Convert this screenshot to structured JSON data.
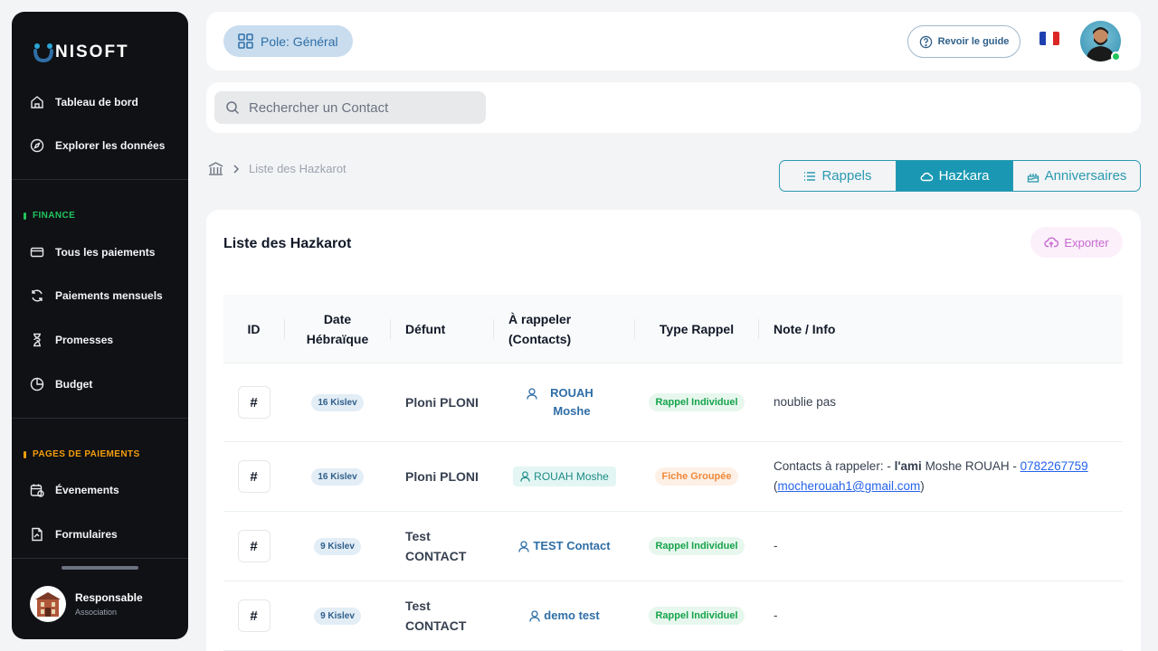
{
  "brand": {
    "logo_text": "NISOFT"
  },
  "sidebar": {
    "items": [
      {
        "label": "Tableau de bord",
        "icon": "home-icon"
      },
      {
        "label": "Explorer les données",
        "icon": "compass-icon"
      }
    ],
    "sections": [
      {
        "label": "FINANCE",
        "color": "#22c55e",
        "items": [
          {
            "label": "Tous les paiements",
            "icon": "credit-card-icon"
          },
          {
            "label": "Paiements mensuels",
            "icon": "refresh-icon"
          },
          {
            "label": "Promesses",
            "icon": "hourglass-icon"
          },
          {
            "label": "Budget",
            "icon": "pie-chart-icon"
          }
        ]
      },
      {
        "label": "PAGES DE PAIEMENTS",
        "color": "#f59e0b",
        "items": [
          {
            "label": "Évenements",
            "icon": "calendar-icon"
          },
          {
            "label": "Formulaires",
            "icon": "document-icon"
          }
        ]
      }
    ],
    "profile": {
      "name": "Responsable",
      "role": "Association"
    }
  },
  "header": {
    "pole_label": "Pole: Général",
    "guide_label": "Revoir le guide",
    "language": "fr"
  },
  "search": {
    "placeholder": "Rechercher un Contact"
  },
  "breadcrumb": {
    "current": "Liste des Hazkarot"
  },
  "tabs": [
    {
      "label": "Rappels",
      "active": false
    },
    {
      "label": "Hazkara",
      "active": true
    },
    {
      "label": "Anniversaires",
      "active": false
    }
  ],
  "card": {
    "title": "Liste des Hazkarot",
    "export_label": "Exporter"
  },
  "table": {
    "columns": [
      "ID",
      "Date Hébraïque",
      "Défunt",
      "À rappeler (Contacts)",
      "Type Rappel",
      "Note / Info"
    ],
    "rows": [
      {
        "id": "#",
        "date": "16 Kislev",
        "defunt": "Ploni PLONI",
        "contact": "ROUAH Moshe",
        "contact_style": "link",
        "type": "Rappel Individuel",
        "type_style": "green",
        "note": "noublie pas"
      },
      {
        "id": "#",
        "date": "16 Kislev",
        "defunt": "Ploni PLONI",
        "contact": "ROUAH Moshe",
        "contact_style": "pill",
        "type": "Fiche Groupée",
        "type_style": "orange",
        "note_parts": {
          "prefix": "Contacts à rappeler: - ",
          "bold": "l'ami",
          "name": " Moshe ROUAH - ",
          "phone": "0782267759",
          "open": "(",
          "email": "mocherouah1@gmail.com",
          "close": ")"
        }
      },
      {
        "id": "#",
        "date": "9 Kislev",
        "defunt": "Test CONTACT",
        "contact": "TEST Contact",
        "contact_style": "link",
        "type": "Rappel Individuel",
        "type_style": "green",
        "note": "-"
      },
      {
        "id": "#",
        "date": "9 Kislev",
        "defunt": "Test CONTACT",
        "contact": "demo test",
        "contact_style": "link",
        "type": "Rappel Individuel",
        "type_style": "green",
        "note": "-"
      }
    ]
  }
}
